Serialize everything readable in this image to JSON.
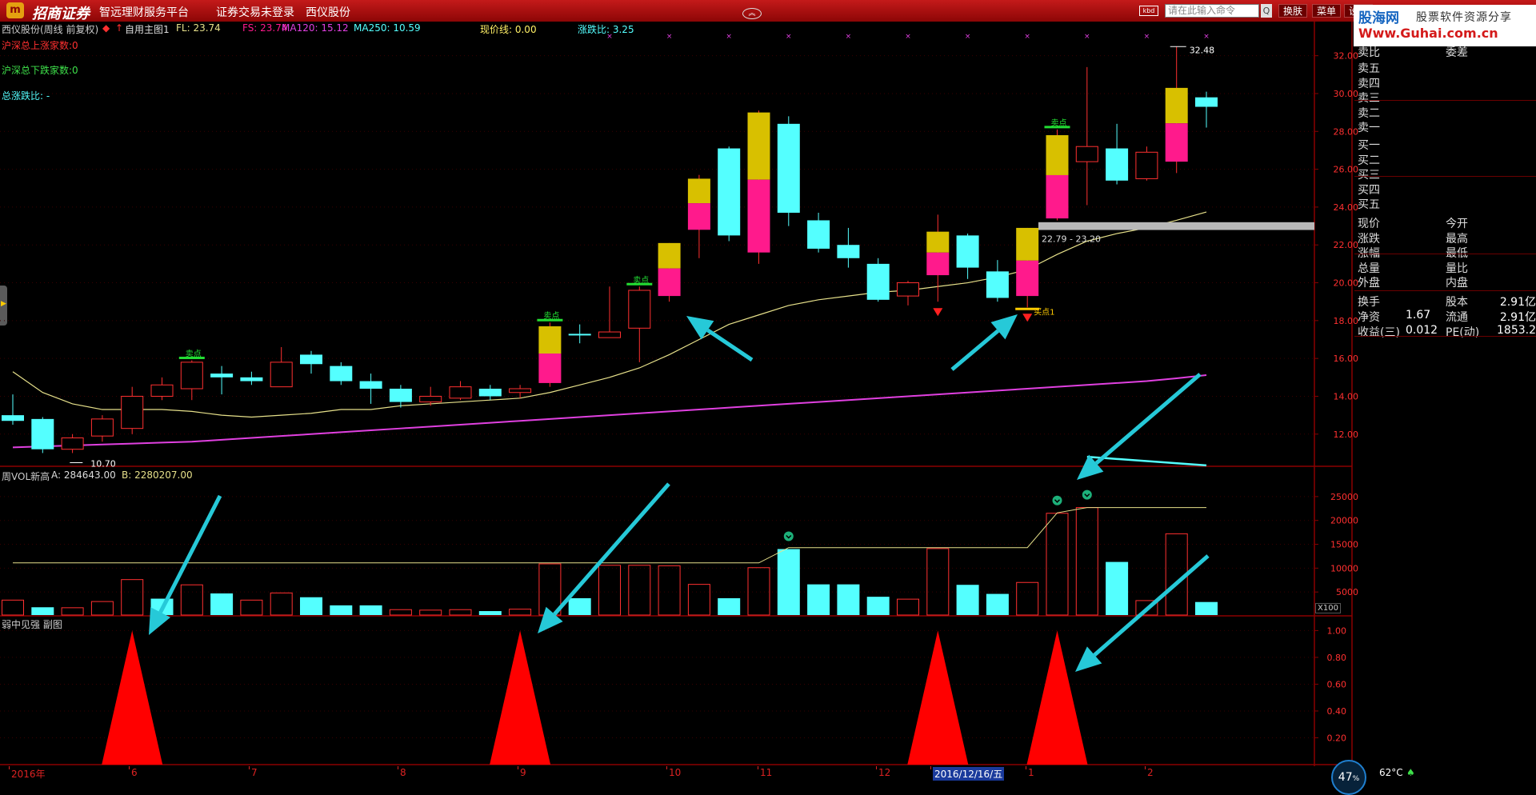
{
  "titlebar": {
    "logo": "m",
    "brand": "招商证券",
    "slogan": "智远理财服务平台",
    "login_status": "证券交易未登录",
    "stock_name": "西仪股份",
    "search_placeholder": "请在此输入命令",
    "search_btn": "Q",
    "keyboard_icon": "kbd",
    "btn_switch": "换肤",
    "btn_menu": "菜单",
    "btn_settings": "设置"
  },
  "watermark": {
    "line1a": "股海网",
    "line1b": "股票软件资源分享",
    "line2": "Www.Guhai.com.cn"
  },
  "infobar": {
    "title": "西仪股份(周线 前复权)",
    "marker": "◆",
    "self_select": "自用主图1",
    "fl": "FL: 23.74",
    "fs": "FS: 23.74",
    "ma120": "MA120: 15.12",
    "ma250": "MA250: 10.59",
    "price_line": "现价线: 0.00",
    "rise_ratio": "涨跌比: 3.25"
  },
  "side_texts": {
    "up_count": "沪深总上涨家数:0",
    "down_count": "沪深总下跌家数:0",
    "total_ratio": "总涨跌比: -"
  },
  "main_panel": {
    "y_ticks": [
      "32.00",
      "30.00",
      "28.00",
      "26.00",
      "24.00",
      "22.00",
      "20.00",
      "18.00",
      "16.00",
      "14.00",
      "12.00"
    ],
    "low_label": "10.70",
    "high_label": "32.48",
    "range_label": "22.79 - 23.20",
    "sell_label": "卖点",
    "buy_label": "买点1"
  },
  "vol_panel": {
    "title": "周VOL新高",
    "a_value": "A: 284643.00",
    "b_value": "B: 2280207.00",
    "y_ticks": [
      "25000",
      "20000",
      "15000",
      "10000",
      "5000"
    ],
    "unit": "X100"
  },
  "sub_panel": {
    "title": "弱中见强 副图",
    "y_ticks": [
      "1.00",
      "0.80",
      "0.60",
      "0.40",
      "0.20"
    ]
  },
  "right_panel": {
    "header_a": "卖比",
    "header_b": "委差",
    "sell_levels": [
      "卖五",
      "卖四",
      "卖三",
      "卖二",
      "卖一"
    ],
    "buy_levels": [
      "买一",
      "买二",
      "买三",
      "买四",
      "买五"
    ],
    "quote_left": [
      "现价",
      "涨跌",
      "涨幅",
      "总量",
      "外盘"
    ],
    "quote_right": [
      "今开",
      "最高",
      "最低",
      "量比",
      "内盘"
    ],
    "turnover": "换手",
    "share_capital": "股本",
    "share_capital_val": "2.91亿",
    "net_assets": "净资",
    "net_assets_val": "1.67",
    "float": "流通",
    "float_val": "2.91亿",
    "earnings": "收益(三)",
    "earnings_val": "0.012",
    "pe": "PE(动)",
    "pe_val": "1853.2"
  },
  "timeline": {
    "labels": [
      "2016年",
      "6",
      "7",
      "8",
      "9",
      "10",
      "11",
      "12",
      "2016/12/16/五",
      "1",
      "2"
    ]
  },
  "status": {
    "gauge": "47",
    "gauge_unit": "%",
    "temp": "62°C",
    "leaf": "♠"
  },
  "colors": {
    "up": "#ff3030",
    "down": "#54ffff",
    "gold": "#d8c000",
    "pink": "#ff1a8c",
    "ma_yellow": "#e6e08a",
    "ma_magenta": "#e040e0",
    "grid": "#8a0000"
  },
  "chart_data": [
    {
      "type": "candlestick",
      "title": "西仪股份(周线 前复权)",
      "ylim": [
        10.3,
        33.0
      ],
      "candles": [
        {
          "o": 13.0,
          "c": 12.7,
          "h": 14.1,
          "l": 12.5
        },
        {
          "o": 12.8,
          "c": 11.2,
          "h": 12.9,
          "l": 11.0
        },
        {
          "o": 11.2,
          "c": 11.8,
          "h": 12.0,
          "l": 11.0
        },
        {
          "o": 11.9,
          "c": 12.8,
          "h": 13.0,
          "l": 11.6
        },
        {
          "o": 12.3,
          "c": 14.0,
          "h": 14.5,
          "l": 12.0
        },
        {
          "o": 14.0,
          "c": 14.6,
          "h": 15.0,
          "l": 13.8
        },
        {
          "o": 14.4,
          "c": 15.8,
          "h": 15.9,
          "l": 13.8
        },
        {
          "o": 15.2,
          "c": 15.0,
          "h": 15.6,
          "l": 14.1
        },
        {
          "o": 15.0,
          "c": 14.8,
          "h": 15.3,
          "l": 14.6
        },
        {
          "o": 14.5,
          "c": 15.8,
          "h": 16.6,
          "l": 14.5
        },
        {
          "o": 16.2,
          "c": 15.7,
          "h": 16.4,
          "l": 15.2
        },
        {
          "o": 15.6,
          "c": 14.8,
          "h": 15.8,
          "l": 14.6
        },
        {
          "o": 14.8,
          "c": 14.4,
          "h": 15.2,
          "l": 13.6
        },
        {
          "o": 14.4,
          "c": 13.7,
          "h": 14.6,
          "l": 13.4
        },
        {
          "o": 13.7,
          "c": 14.0,
          "h": 14.5,
          "l": 13.5
        },
        {
          "o": 13.9,
          "c": 14.5,
          "h": 14.8,
          "l": 13.8
        },
        {
          "o": 14.4,
          "c": 14.0,
          "h": 14.6,
          "l": 13.8
        },
        {
          "o": 14.2,
          "c": 14.4,
          "h": 14.6,
          "l": 13.9
        },
        {
          "o": 14.7,
          "c": 17.7,
          "h": 17.9,
          "l": 14.5
        },
        {
          "o": 17.3,
          "c": 17.25,
          "h": 17.8,
          "l": 16.8
        },
        {
          "o": 17.1,
          "c": 17.4,
          "h": 19.8,
          "l": 17.1
        },
        {
          "o": 17.6,
          "c": 19.6,
          "h": 19.8,
          "l": 15.8
        },
        {
          "o": 19.3,
          "c": 22.1,
          "h": 22.1,
          "l": 19.0
        },
        {
          "o": 22.8,
          "c": 25.5,
          "h": 25.7,
          "l": 21.3
        },
        {
          "o": 27.1,
          "c": 22.5,
          "h": 27.2,
          "l": 22.2
        },
        {
          "o": 21.6,
          "c": 29.0,
          "h": 29.1,
          "l": 21.0
        },
        {
          "o": 28.4,
          "c": 23.7,
          "h": 28.8,
          "l": 23.0
        },
        {
          "o": 23.3,
          "c": 21.8,
          "h": 23.7,
          "l": 21.6
        },
        {
          "o": 22.0,
          "c": 21.3,
          "h": 22.9,
          "l": 20.8
        },
        {
          "o": 21.0,
          "c": 19.1,
          "h": 21.3,
          "l": 19.0
        },
        {
          "o": 19.3,
          "c": 20.0,
          "h": 20.1,
          "l": 18.8
        },
        {
          "o": 20.4,
          "c": 22.7,
          "h": 23.6,
          "l": 19.0
        },
        {
          "o": 22.5,
          "c": 20.8,
          "h": 22.6,
          "l": 20.2
        },
        {
          "o": 20.6,
          "c": 19.2,
          "h": 21.2,
          "l": 19.0
        },
        {
          "o": 19.3,
          "c": 22.9,
          "h": 22.9,
          "l": 18.7
        },
        {
          "o": 23.4,
          "c": 27.8,
          "h": 28.1,
          "l": 23.3
        },
        {
          "o": 26.4,
          "c": 27.2,
          "h": 31.4,
          "l": 24.1
        },
        {
          "o": 27.1,
          "c": 25.4,
          "h": 28.4,
          "l": 25.2
        },
        {
          "o": 25.5,
          "c": 26.9,
          "h": 27.2,
          "l": 25.4
        },
        {
          "o": 26.4,
          "c": 30.3,
          "h": 32.48,
          "l": 25.8
        },
        {
          "o": 29.8,
          "c": 29.3,
          "h": 30.1,
          "l": 28.2
        }
      ],
      "ma_fl_yellow": [
        15.3,
        14.2,
        13.6,
        13.3,
        13.3,
        13.3,
        13.2,
        13.0,
        12.9,
        13.0,
        13.1,
        13.3,
        13.3,
        13.5,
        13.6,
        13.7,
        13.8,
        13.9,
        14.2,
        14.6,
        15.0,
        15.5,
        16.2,
        17.0,
        17.8,
        18.3,
        18.8,
        19.1,
        19.3,
        19.5,
        19.6,
        19.8,
        20.0,
        20.3,
        20.7,
        21.5,
        22.2,
        22.6,
        22.9,
        23.3,
        23.74
      ],
      "ma120": [
        11.3,
        11.35,
        11.4,
        11.45,
        11.5,
        11.55,
        11.6,
        11.7,
        11.8,
        11.9,
        12.0,
        12.1,
        12.2,
        12.3,
        12.4,
        12.5,
        12.6,
        12.7,
        12.8,
        12.9,
        13.0,
        13.1,
        13.2,
        13.3,
        13.4,
        13.5,
        13.6,
        13.7,
        13.8,
        13.9,
        14.0,
        14.1,
        14.2,
        14.3,
        14.4,
        14.5,
        14.6,
        14.7,
        14.8,
        14.95,
        15.12
      ],
      "sell_signals": [
        6,
        18,
        21,
        35
      ],
      "buy_signals": [
        31,
        34
      ]
    },
    {
      "type": "bar",
      "title": "周VOL新高",
      "ylim": [
        0,
        28500
      ],
      "values": [
        3300,
        1800,
        1700,
        3000,
        7600,
        3600,
        6500,
        4700,
        3300,
        4800,
        3900,
        2200,
        2200,
        1300,
        1200,
        1300,
        1000,
        1400,
        10900,
        3700,
        10600,
        10600,
        10500,
        6600,
        3700,
        10100,
        14000,
        6600,
        6600,
        4000,
        3500,
        14100,
        6500,
        4600,
        7000,
        21500,
        22700,
        11300,
        3200,
        17200,
        2900
      ],
      "up_flags": [
        1,
        0,
        1,
        1,
        1,
        0,
        1,
        0,
        1,
        1,
        0,
        0,
        0,
        1,
        1,
        1,
        0,
        1,
        1,
        0,
        1,
        1,
        1,
        1,
        0,
        1,
        0,
        0,
        0,
        0,
        1,
        1,
        0,
        0,
        1,
        1,
        1,
        0,
        1,
        1,
        0
      ],
      "line_hhv": [
        11100,
        11100,
        11100,
        11100,
        11100,
        11100,
        11100,
        11100,
        11100,
        11100,
        11100,
        11100,
        11100,
        11100,
        11100,
        11100,
        11100,
        11100,
        11100,
        11100,
        11100,
        11100,
        11100,
        11100,
        11100,
        11100,
        14300,
        14300,
        14300,
        14300,
        14300,
        14300,
        14300,
        14300,
        14300,
        21600,
        22700,
        22700,
        22700,
        22700,
        22700
      ],
      "marks": [
        26,
        35,
        36
      ]
    },
    {
      "type": "area",
      "title": "弱中见强 副图",
      "ylim": [
        0,
        1.08
      ],
      "triangles": [
        4,
        17,
        31,
        35
      ]
    }
  ]
}
